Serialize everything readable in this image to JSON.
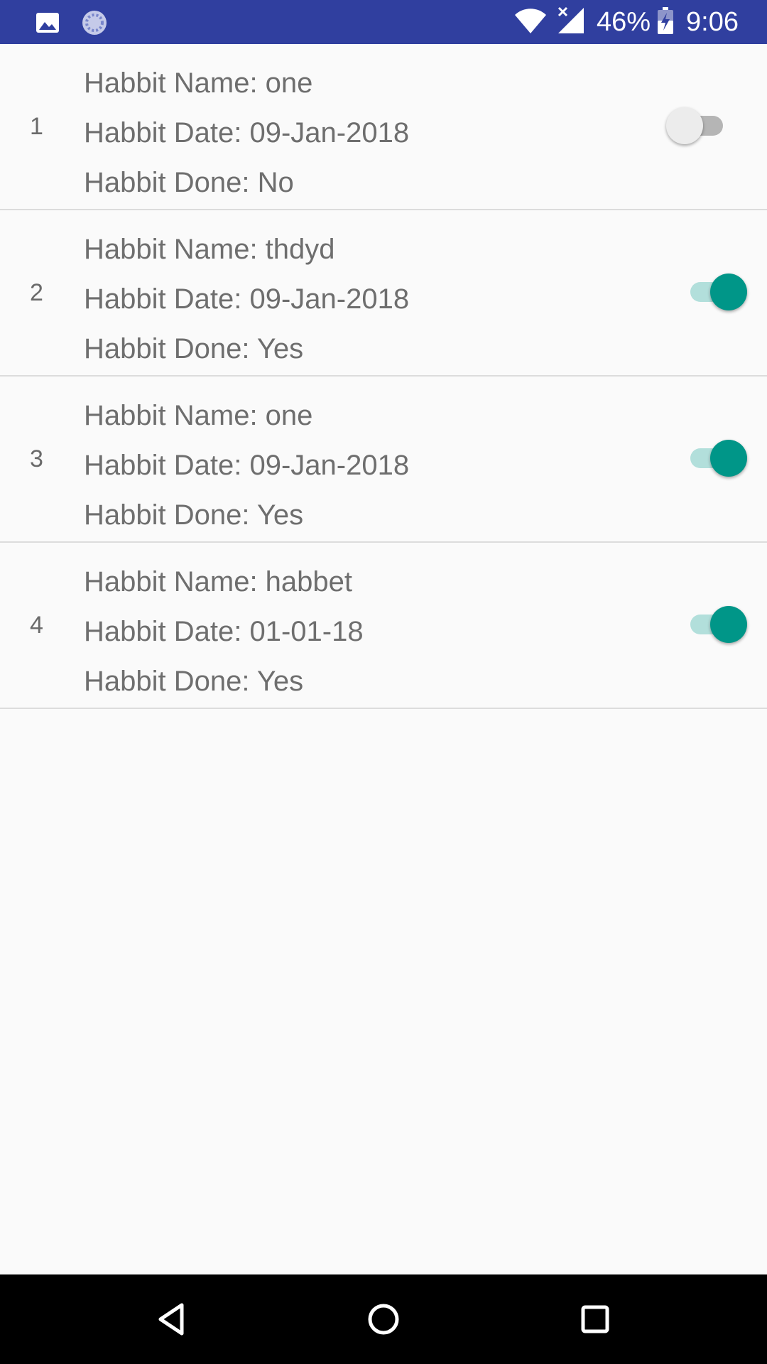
{
  "status_bar": {
    "battery_percent": "46%",
    "time": "9:06",
    "icons": [
      "gallery-notification-icon",
      "sync-notification-icon",
      "wifi-icon",
      "cellular-no-signal-icon",
      "battery-charging-icon"
    ]
  },
  "habits": [
    {
      "index": "1",
      "name_line": "Habbit Name: one",
      "date_line": "Habbit Date: 09-Jan-2018",
      "done_line": "Habbit Done: No",
      "done": false
    },
    {
      "index": "2",
      "name_line": "Habbit Name: thdyd",
      "date_line": "Habbit Date: 09-Jan-2018",
      "done_line": "Habbit Done: Yes",
      "done": true
    },
    {
      "index": "3",
      "name_line": "Habbit Name: one",
      "date_line": "Habbit Date: 09-Jan-2018",
      "done_line": "Habbit Done: Yes",
      "done": true
    },
    {
      "index": "4",
      "name_line": "Habbit Name: habbet",
      "date_line": "Habbit Date: 01-01-18",
      "done_line": "Habbit Done: Yes",
      "done": true
    }
  ],
  "colors": {
    "status_bar": "#303f9f",
    "switch_on_thumb": "#009688",
    "switch_on_track": "#b2dfdb",
    "switch_off_thumb": "#ececec",
    "switch_off_track": "#b5b5b5"
  },
  "nav_bar": {
    "buttons": [
      "back-icon",
      "home-icon",
      "recents-icon"
    ]
  }
}
